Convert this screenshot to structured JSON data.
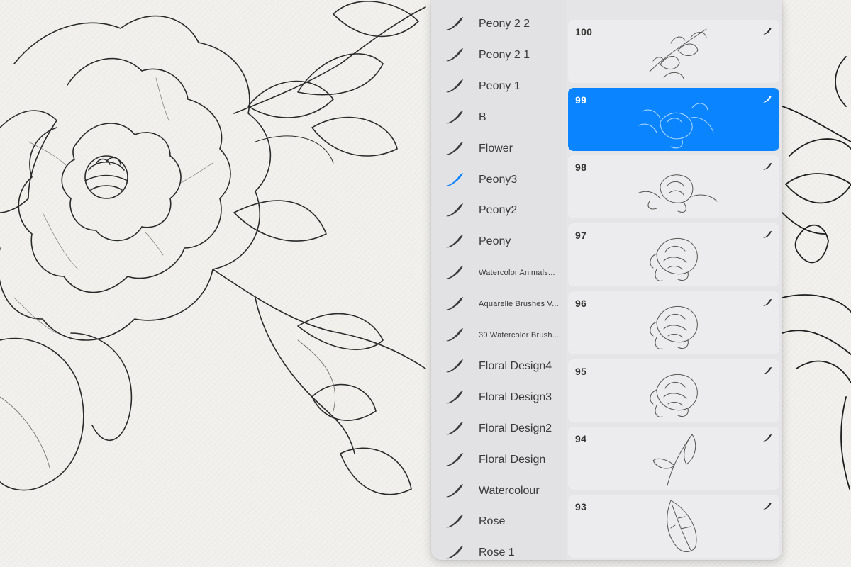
{
  "brush_sets": [
    {
      "label": "Peony 2 2",
      "active": false,
      "size": "normal"
    },
    {
      "label": "Peony 2 1",
      "active": false,
      "size": "normal"
    },
    {
      "label": "Peony 1",
      "active": false,
      "size": "normal"
    },
    {
      "label": "B",
      "active": false,
      "size": "normal"
    },
    {
      "label": "Flower",
      "active": false,
      "size": "normal"
    },
    {
      "label": "Peony3",
      "active": true,
      "size": "normal"
    },
    {
      "label": "Peony2",
      "active": false,
      "size": "normal"
    },
    {
      "label": "Peony",
      "active": false,
      "size": "normal"
    },
    {
      "label": "Watercolor Animals...",
      "active": false,
      "size": "small"
    },
    {
      "label": "Aquarelle Brushes V...",
      "active": false,
      "size": "small"
    },
    {
      "label": "30 Watercolor Brush...",
      "active": false,
      "size": "small"
    },
    {
      "label": "Floral Design4",
      "active": false,
      "size": "normal"
    },
    {
      "label": "Floral Design3",
      "active": false,
      "size": "normal"
    },
    {
      "label": "Floral Design2",
      "active": false,
      "size": "normal"
    },
    {
      "label": "Floral Design",
      "active": false,
      "size": "normal"
    },
    {
      "label": "Watercolour",
      "active": false,
      "size": "normal"
    },
    {
      "label": "Rose",
      "active": false,
      "size": "normal"
    },
    {
      "label": "Rose 1",
      "active": false,
      "size": "normal"
    }
  ],
  "brushes": [
    {
      "number": "100",
      "selected": false,
      "preview": "floral-spray-icon"
    },
    {
      "number": "99",
      "selected": true,
      "preview": "peony-bouquet-icon"
    },
    {
      "number": "98",
      "selected": false,
      "preview": "peony-with-leaves-icon"
    },
    {
      "number": "97",
      "selected": false,
      "preview": "peony-bloom-icon"
    },
    {
      "number": "96",
      "selected": false,
      "preview": "peony-bloom-icon"
    },
    {
      "number": "95",
      "selected": false,
      "preview": "peony-bloom-icon"
    },
    {
      "number": "94",
      "selected": false,
      "preview": "leaf-sprig-icon"
    },
    {
      "number": "93",
      "selected": false,
      "preview": "single-leaf-icon"
    }
  ],
  "colors": {
    "accent": "#0a84ff",
    "icon_dark": "#3a3a3c",
    "panel_bg": "#e5e5e7",
    "card_bg": "#ececee"
  }
}
